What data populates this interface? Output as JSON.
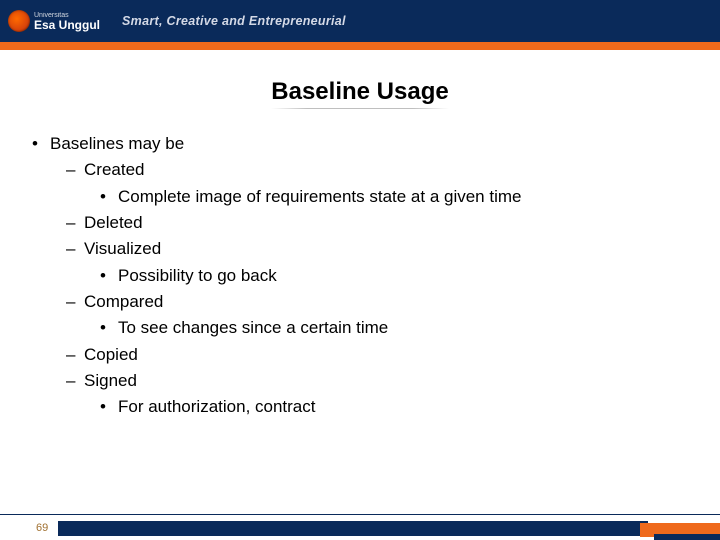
{
  "header": {
    "university_small": "Universitas",
    "university_name": "Esa Unggul",
    "tagline": "Smart, Creative and Entrepreneurial"
  },
  "title": "Baseline Usage",
  "bullets": {
    "l1": "Baselines may be",
    "a": "Created",
    "a1": "Complete image of requirements state at a given time",
    "b": "Deleted",
    "c": "Visualized",
    "c1": "Possibility to go back",
    "d": "Compared",
    "d1": "To see changes since a certain time",
    "e": "Copied",
    "f": "Signed",
    "f1": "For authorization, contract"
  },
  "page_number": "69"
}
